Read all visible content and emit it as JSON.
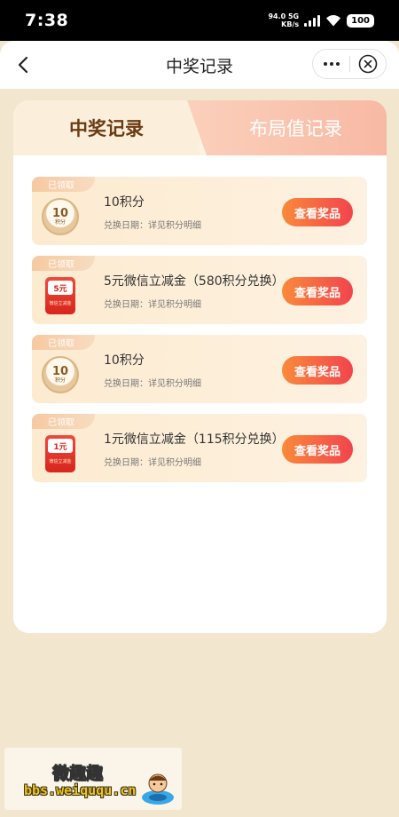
{
  "status_bar": {
    "time": "7:38",
    "net_speed_value": "94.0",
    "net_type": "5G",
    "net_speed_unit": "KB/s",
    "battery": "100"
  },
  "nav": {
    "title": "中奖记录",
    "back_icon": "chevron-left-icon",
    "more_icon": "more-dots-icon",
    "close_icon": "close-circle-icon"
  },
  "tabs": {
    "active": "中奖记录",
    "inactive": "布局值记录"
  },
  "records": [
    {
      "tag": "已领取",
      "icon": "points-coin-icon",
      "icon_value": "10",
      "icon_unit": "积分",
      "title": "10积分",
      "date_label": "兑换日期：详见积分明细",
      "button": "查看奖品"
    },
    {
      "tag": "已领取",
      "icon": "wechat-redpacket-icon",
      "icon_value": "5元",
      "icon_unit": "微信立减金",
      "title": "5元微信立减金（580积分兑换）",
      "date_label": "兑换日期：详见积分明细",
      "button": "查看奖品"
    },
    {
      "tag": "已领取",
      "icon": "points-coin-icon",
      "icon_value": "10",
      "icon_unit": "积分",
      "title": "10积分",
      "date_label": "兑换日期：详见积分明细",
      "button": "查看奖品"
    },
    {
      "tag": "已领取",
      "icon": "wechat-redpacket-icon",
      "icon_value": "1元",
      "icon_unit": "微信立减金",
      "title": "1元微信立减金（115积分兑换）",
      "date_label": "兑换日期：详见积分明细",
      "button": "查看奖品"
    }
  ],
  "watermark": {
    "title": "微趣趣",
    "url": "bbs.weiququ.cn"
  },
  "colors": {
    "page_bg": "#f3e6cf",
    "brand_brown": "#6b3b12",
    "button_gradient_start": "#f98a3b",
    "button_gradient_end": "#f2444d"
  }
}
